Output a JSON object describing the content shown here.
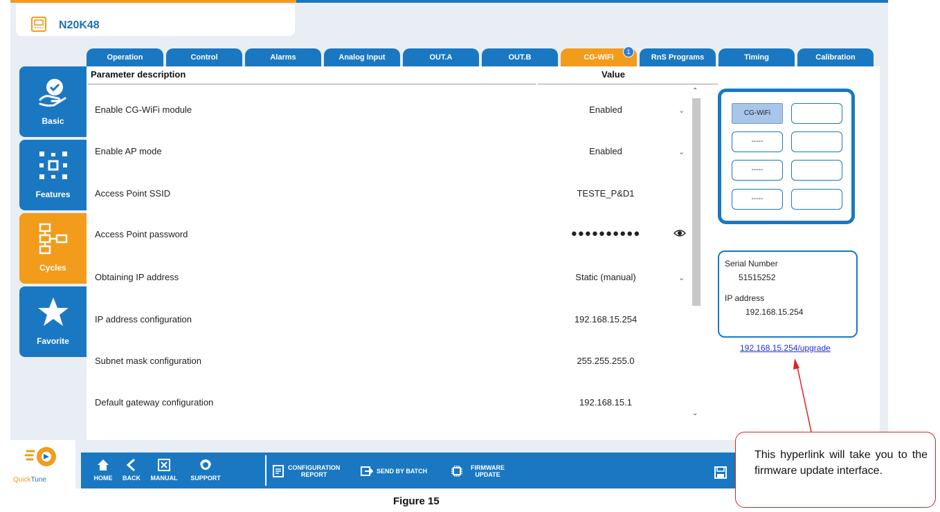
{
  "device": {
    "name": "N20K48",
    "icon": "device-icon"
  },
  "tabs": [
    {
      "label": "Operation"
    },
    {
      "label": "Control"
    },
    {
      "label": "Alarms"
    },
    {
      "label": "Analog Input"
    },
    {
      "label": "OUT.A"
    },
    {
      "label": "OUT.B"
    },
    {
      "label": "CG-WiFi",
      "badge": "1",
      "active": true
    },
    {
      "label": "RnS Programs"
    },
    {
      "label": "Timing"
    },
    {
      "label": "Calibration"
    }
  ],
  "sidenav": [
    {
      "label": "Basic",
      "icon": "hand-check-icon"
    },
    {
      "label": "Features",
      "icon": "features-grid-icon"
    },
    {
      "label": "Cycles",
      "icon": "cycles-flow-icon",
      "active": true
    },
    {
      "label": "Favorite",
      "icon": "star-icon"
    }
  ],
  "table": {
    "header_desc": "Parameter description",
    "header_value": "Value",
    "rows": [
      {
        "desc": "Enable CG-WiFi module",
        "value": "Enabled",
        "control": "dropdown"
      },
      {
        "desc": "Enable AP mode",
        "value": "Enabled",
        "control": "dropdown"
      },
      {
        "desc": "Access Point SSID",
        "value": "TESTE_P&D1",
        "control": "text"
      },
      {
        "desc": "Access Point password",
        "value": "●●●●●●●●●●",
        "control": "password"
      },
      {
        "desc": "Obtaining IP address",
        "value": "Static (manual)",
        "control": "dropdown"
      },
      {
        "desc": "IP address configuration",
        "value": "192.168.15.254",
        "control": "text"
      },
      {
        "desc": "Subnet mask configuration",
        "value": "255.255.255.0",
        "control": "text"
      },
      {
        "desc": "Default gateway configuration",
        "value": "192.168.15.1",
        "control": "text"
      }
    ]
  },
  "grid_panel": {
    "cells": [
      "CG-WiFi",
      "",
      "-----",
      "",
      "-----",
      "",
      "-----",
      ""
    ]
  },
  "info_panel": {
    "serial_label": "Serial Number",
    "serial_value": "51515252",
    "ip_label": "IP address",
    "ip_value": "192.168.15.254"
  },
  "upgrade_link": "192.168.15.254/upgrade",
  "logo": {
    "part1": "Quick",
    "part2": "Tune"
  },
  "bottombar": {
    "home": "HOME",
    "back": "BACK",
    "manual": "MANUAL",
    "support": "SUPPORT",
    "config_report_1": "CONFIGURATION",
    "config_report_2": "REPORT",
    "send_batch": "SEND BY BATCH",
    "firmware_1": "FIRMWARE",
    "firmware_2": "UPDATE"
  },
  "callout": "This hyperlink will take you to the firmware update interface.",
  "caption": "Figure 15",
  "colors": {
    "brand_blue": "#1a78c2",
    "accent_orange": "#f39b1b",
    "link": "#1b2fe0",
    "annotation_red": "#e02020"
  }
}
